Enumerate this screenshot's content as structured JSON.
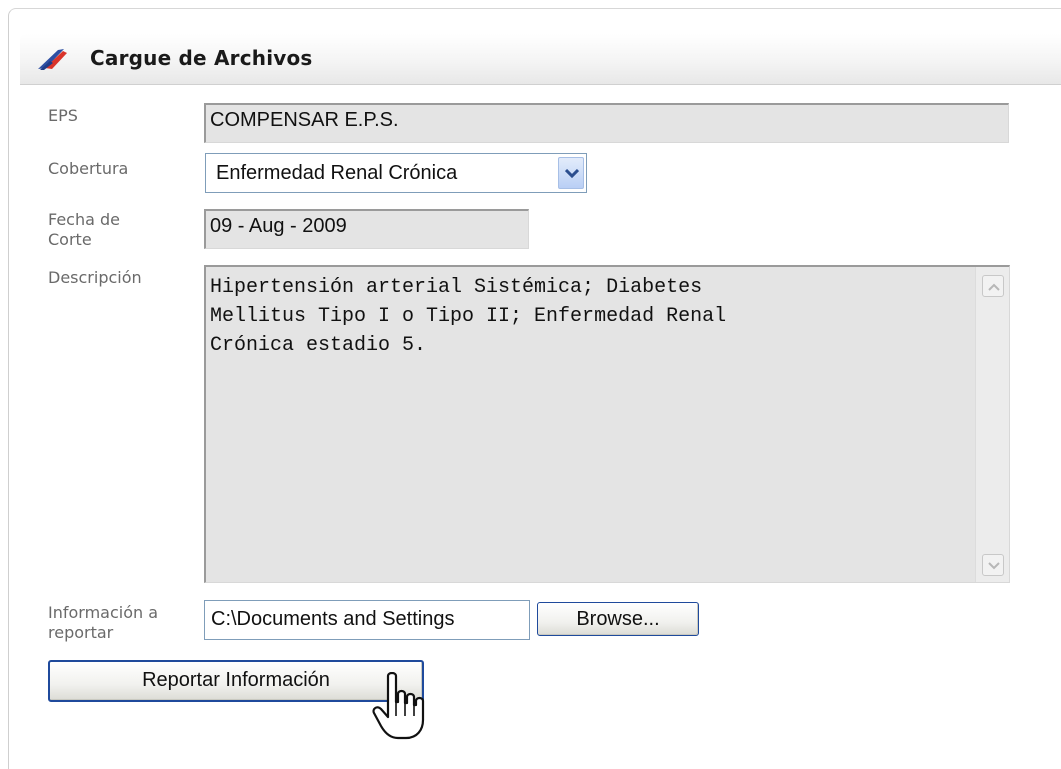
{
  "panel": {
    "title": "Cargue de Archivos",
    "icon": "feather-pen-icon"
  },
  "form": {
    "eps": {
      "label": "EPS",
      "value": "COMPENSAR E.P.S."
    },
    "cobertura": {
      "label": "Cobertura",
      "selected": "Enfermedad Renal Crónica"
    },
    "fecha_corte": {
      "label_line1": "Fecha de",
      "label_line2": "Corte",
      "value": "09 - Aug - 2009"
    },
    "descripcion": {
      "label": "Descripción",
      "lines": [
        "Hipertensión arterial Sistémica; Diabetes",
        "Mellitus Tipo I o Tipo II; Enfermedad Renal",
        "Crónica estadio 5."
      ]
    },
    "informacion": {
      "label_line1": "Información a",
      "label_line2": "reportar",
      "file_value": "C:\\Documents and Settings",
      "browse_label": "Browse..."
    }
  },
  "actions": {
    "report_label": "Reportar Información"
  },
  "colors": {
    "field_bg": "#e4e4e4",
    "label": "#6a6a6a",
    "button_border": "#1f4a9c",
    "select_border": "#7f9db9"
  }
}
